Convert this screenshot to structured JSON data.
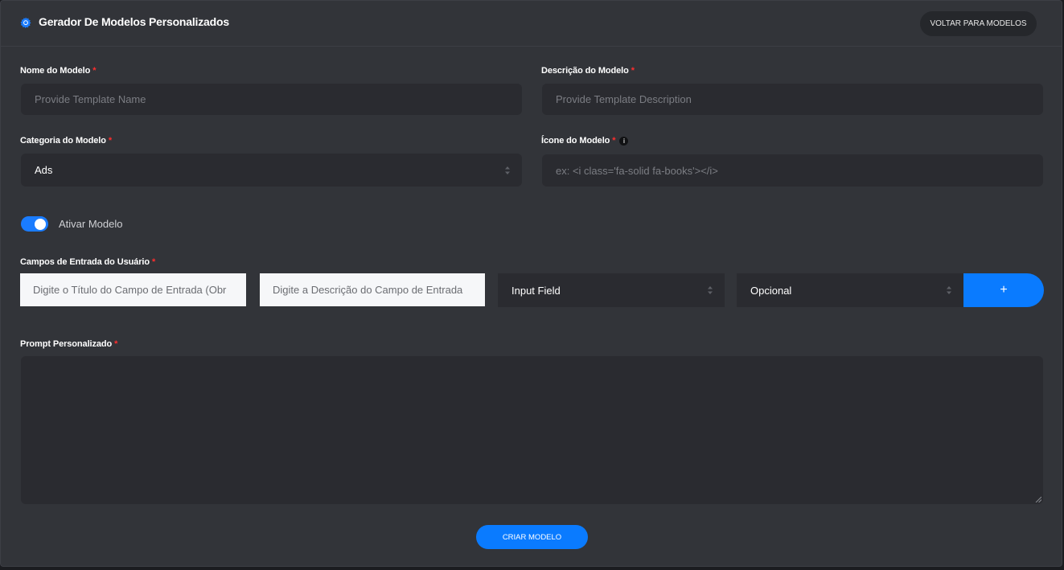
{
  "header": {
    "title": "Gerador De Modelos Personalizados",
    "back_button": "VOLTAR PARA MODELOS"
  },
  "form": {
    "name": {
      "label": "Nome do Modelo",
      "required_mark": "*",
      "placeholder": "Provide Template Name"
    },
    "description": {
      "label": "Descrição do Modelo",
      "required_mark": "*",
      "placeholder": "Provide Template Description"
    },
    "category": {
      "label": "Categoria do Modelo",
      "required_mark": "*",
      "selected": "Ads"
    },
    "icon": {
      "label": "Ícone do Modelo",
      "required_mark": "*",
      "info_glyph": "i",
      "placeholder": "ex: <i class='fa-solid fa-books'></i>"
    },
    "toggle": {
      "label": "Ativar Modelo",
      "on": true
    },
    "input_fields": {
      "label": "Campos de Entrada do Usuário",
      "required_mark": "*",
      "title_placeholder": "Digite o Título do Campo de Entrada (Obr",
      "description_placeholder": "Digite a Descrição do Campo de Entrada",
      "type_selected": "Input Field",
      "required_selected": "Opcional",
      "add_button": "+"
    },
    "prompt": {
      "label": "Prompt Personalizado",
      "required_mark": "*"
    },
    "submit_button": "CRIAR MODELO"
  },
  "colors": {
    "accent": "#0a7bff",
    "required": "#ff2e2e",
    "panel": "#323439",
    "field": "#2a2b30"
  },
  "icons": {
    "header": "gear-badge-icon",
    "select": "select-arrows-icon",
    "info": "info-icon",
    "resize": "resize-grip-icon"
  }
}
